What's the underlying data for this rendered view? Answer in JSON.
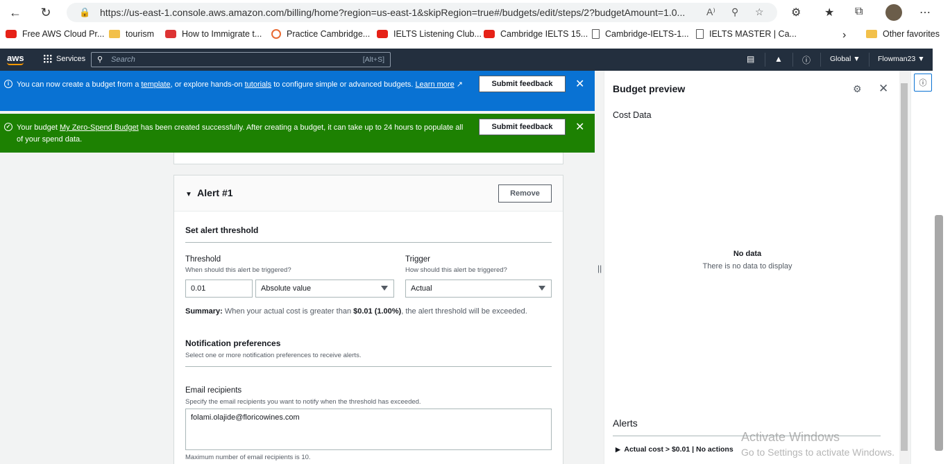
{
  "browser": {
    "url": "https://us-east-1.console.aws.amazon.com/billing/home?region=us-east-1&skipRegion=true#/budgets/edit/steps/2?budgetAmount=1.0...",
    "bookmarks": [
      {
        "label": "Free AWS Cloud Pr...",
        "icon": "youtube-icon"
      },
      {
        "label": "tourism",
        "icon": "folder-icon"
      },
      {
        "label": "How to Immigrate t...",
        "icon": "site-icon"
      },
      {
        "label": "Practice Cambridge...",
        "icon": "site-icon"
      },
      {
        "label": "IELTS Listening Club...",
        "icon": "youtube-icon"
      },
      {
        "label": "Cambridge IELTS 15...",
        "icon": "youtube-icon"
      },
      {
        "label": "Cambridge-IELTS-1...",
        "icon": "document-icon"
      },
      {
        "label": "IELTS MASTER | Ca...",
        "icon": "document-icon"
      }
    ],
    "other_favorites": "Other favorites"
  },
  "aws_header": {
    "logo": "aws",
    "services": "Services",
    "search_placeholder": "Search",
    "search_hint": "[Alt+S]",
    "region": "Global ▼",
    "user": "Flowman23 ▼"
  },
  "flash_info": {
    "text_1": "You can now create a budget from a ",
    "link_template": "template",
    "text_2": ", or explore hands-on ",
    "link_tutorials": "tutorials",
    "text_3": " to configure simple or advanced budgets. ",
    "link_learn_more": "Learn more",
    "button": "Submit feedback"
  },
  "flash_success": {
    "text_1": "Your budget ",
    "link_budget": "My Zero-Spend Budget",
    "text_2": " has been created successfully. After creating a budget, it can take up to 24 hours to populate all of your spend data.",
    "button": "Submit feedback"
  },
  "alert": {
    "title": "Alert #1",
    "remove": "Remove",
    "threshold_section": "Set alert threshold",
    "threshold_label": "Threshold",
    "threshold_desc": "When should this alert be triggered?",
    "threshold_value": "0.01",
    "threshold_type": "Absolute value",
    "trigger_label": "Trigger",
    "trigger_desc": "How should this alert be triggered?",
    "trigger_value": "Actual",
    "summary_label": "Summary:",
    "summary_1": " When your actual cost is greater than ",
    "summary_amount": "$0.01 (1.00%)",
    "summary_2": ", the alert threshold will be exceeded.",
    "notif_section": "Notification preferences",
    "notif_desc": "Select one or more notification preferences to receive alerts.",
    "email_label": "Email recipients",
    "email_desc": "Specify the email recipients you want to notify when the threshold has exceeded.",
    "email_value": "folami.olajide@floricowines.com",
    "email_limit": "Maximum number of email recipients is 10."
  },
  "panel": {
    "title": "Budget preview",
    "cost_data": "Cost Data",
    "no_data": "No data",
    "no_data_desc": "There is no data to display",
    "alerts_title": "Alerts",
    "alert_row": "Actual cost > $0.01 | No actions"
  },
  "watermark": {
    "line1": "Activate Windows",
    "line2": "Go to Settings to activate Windows."
  }
}
